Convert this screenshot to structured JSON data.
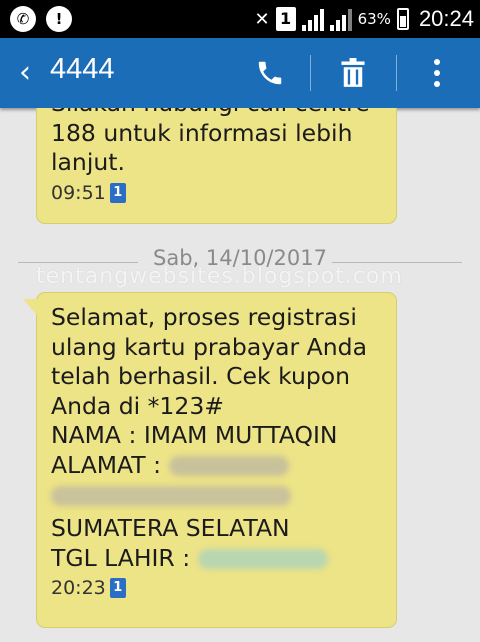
{
  "status_bar": {
    "left_icons": [
      "whatsapp-icon",
      "notification-icon"
    ],
    "sim_label": "1",
    "battery_percent": "63%",
    "time": "20:24"
  },
  "action_bar": {
    "title": "4444",
    "icons": [
      "back-icon",
      "phone-icon",
      "delete-icon",
      "more-icon"
    ]
  },
  "messages": [
    {
      "lines": [
        "Silakan hubungi call centre",
        "188 untuk informasi lebih",
        "lanjut."
      ],
      "time": "09:51",
      "sim": "1"
    },
    {
      "date": "Sab, 14/10/2017",
      "watermark": "tentangwebsites.blogspot.com",
      "lines": [
        "Selamat, proses registrasi",
        "ulang kartu prabayar Anda",
        "telah berhasil. Cek kupon",
        "Anda di *123#",
        "NAMA : IMAM MUTTAQIN",
        "ALAMAT :"
      ],
      "lines_after_blur": [
        "SUMATERA SELATAN",
        "TGL LAHIR :"
      ],
      "time": "20:23",
      "sim": "1"
    }
  ],
  "colors": {
    "action_bar": "#1c6db8",
    "bubble": "#ede387",
    "background": "#e7e7e7"
  }
}
